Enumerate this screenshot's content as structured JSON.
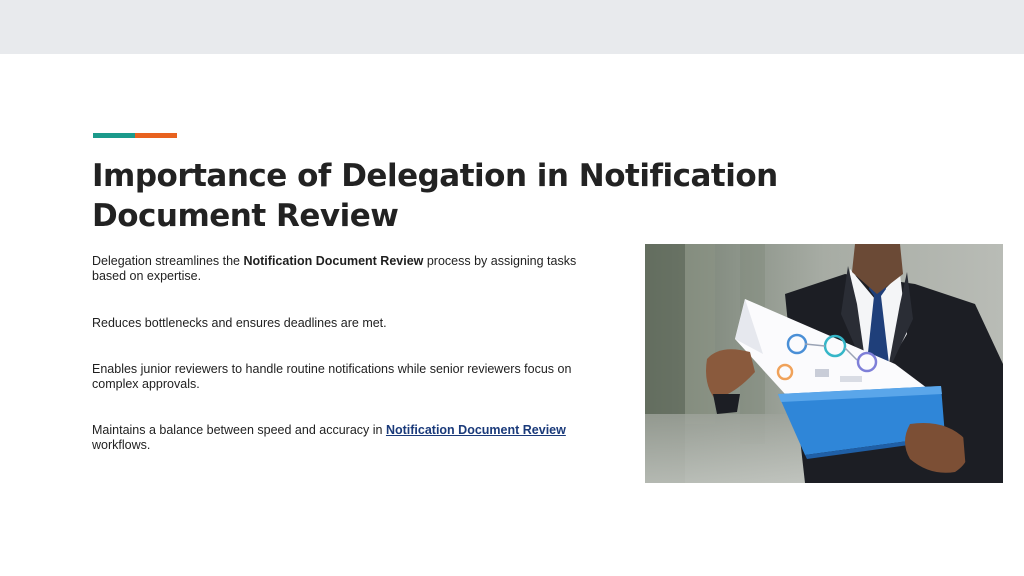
{
  "slide": {
    "title": "Importance of Delegation in Notification Document Review",
    "bullets": [
      {
        "pre": "Delegation streamlines the ",
        "bold": "Notification Document Review",
        "post": " process by assigning tasks based on expertise."
      },
      {
        "text": "Reduces bottlenecks and ensures deadlines are met."
      },
      {
        "text": "Enables junior reviewers to handle routine notifications while senior reviewers focus on complex approvals."
      },
      {
        "pre": "Maintains a balance between speed and accuracy in ",
        "link": "Notification Document Review",
        "post": " workflows."
      }
    ],
    "photo_icon": "businessman-reviewing-documents-photo"
  },
  "colors": {
    "accent_teal": "#1b9a8b",
    "accent_orange": "#e8621f",
    "link": "#1a3a7a",
    "top_bar": "#e8eaed"
  }
}
